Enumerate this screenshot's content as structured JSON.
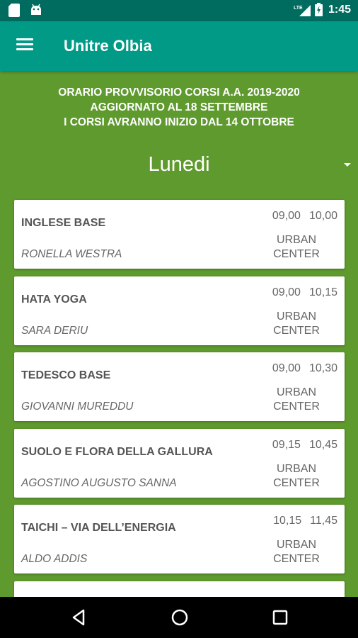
{
  "status_bar": {
    "time": "1:45",
    "network": "LTE"
  },
  "app_bar": {
    "title": "Unitre Olbia",
    "menu_icon": "hamburger-menu-icon"
  },
  "notice": {
    "line1": "ORARIO PROVVISORIO CORSI A.A. 2019-2020",
    "line2": "AGGIORNATO AL 18 SETTEMBRE",
    "line3": "I CORSI AVRANNO INIZIO DAL 14 OTTOBRE"
  },
  "day_selector": {
    "selected": "Lunedi"
  },
  "courses": [
    {
      "name": "INGLESE BASE",
      "teacher": "RONELLA WESTRA",
      "start": "09,00",
      "end": "10,00",
      "place_line1": "URBAN",
      "place_line2": "CENTER"
    },
    {
      "name": "HATA YOGA",
      "teacher": "SARA DERIU",
      "start": "09,00",
      "end": "10,15",
      "place_line1": "URBAN",
      "place_line2": "CENTER"
    },
    {
      "name": "TEDESCO BASE",
      "teacher": "GIOVANNI MUREDDU",
      "start": "09,00",
      "end": "10,30",
      "place_line1": "URBAN",
      "place_line2": "CENTER"
    },
    {
      "name": "SUOLO E FLORA DELLA GALLURA",
      "teacher": "AGOSTINO AUGUSTO SANNA",
      "start": "09,15",
      "end": "10,45",
      "place_line1": "URBAN",
      "place_line2": "CENTER"
    },
    {
      "name": "TAICHI – VIA DELL’ENERGIA",
      "teacher": "ALDO ADDIS",
      "start": "10,15",
      "end": "11,45",
      "place_line1": "URBAN",
      "place_line2": "CENTER"
    }
  ],
  "colors": {
    "status_bar": "#006b5f",
    "app_bar": "#009a86",
    "background": "#5f9a2e"
  }
}
